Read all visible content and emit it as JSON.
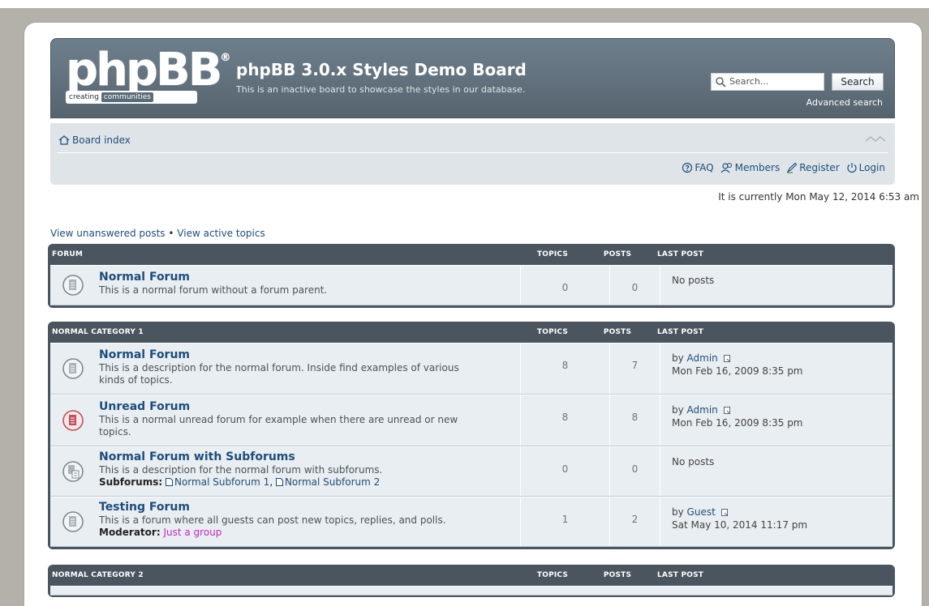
{
  "header": {
    "logo_text": "phpBB",
    "logo_reg": "®",
    "logo_tag_1": "creating",
    "logo_tag_2": "communities",
    "title": "phpBB 3.0.x Styles Demo Board",
    "description": "This is an inactive board to showcase the styles in our database.",
    "search_placeholder": "Search...",
    "search_button": "Search",
    "advanced_search": "Advanced search"
  },
  "nav": {
    "board_index": "Board index",
    "links": [
      "FAQ",
      "Members",
      "Register",
      "Login"
    ]
  },
  "current_time": "It is currently Mon May 12, 2014 6:53 am",
  "quick_links": [
    "View unanswered posts",
    "•",
    "View active topics"
  ],
  "columns": {
    "topics": "TOPICS",
    "posts": "POSTS",
    "last_post": "LAST POST"
  },
  "categories": [
    {
      "name": "FORUM",
      "forums": [
        {
          "title": "Normal Forum",
          "description": "This is a normal forum without a forum parent.",
          "topics": "0",
          "posts": "0",
          "last_post": "No posts"
        }
      ]
    },
    {
      "name": "NORMAL CATEGORY 1",
      "forums": [
        {
          "title": "Normal Forum",
          "description": "This is a description for the normal forum. Inside find examples of various kinds of topics.",
          "topics": "8",
          "posts": "7",
          "last_by": "by",
          "last_author": "Admin",
          "last_date": "Mon Feb 16, 2009 8:35 pm"
        },
        {
          "title": "Unread Forum",
          "description": "This is a normal unread forum for example when there are unread or new topics.",
          "topics": "8",
          "posts": "8",
          "last_by": "by",
          "last_author": "Admin",
          "last_date": "Mon Feb 16, 2009 8:35 pm"
        },
        {
          "title": "Normal Forum with Subforums",
          "description": "This is a description for the normal forum with subforums.",
          "subforums_label": "Subforums:",
          "subforums": [
            "Normal Subforum 1",
            "Normal Subforum 2"
          ],
          "topics": "0",
          "posts": "0",
          "last_post": "No posts"
        },
        {
          "title": "Testing Forum",
          "description": "This is a forum where all guests can post new topics, replies, and polls.",
          "moderator_label": "Moderator:",
          "moderator": "Just a group",
          "topics": "1",
          "posts": "2",
          "last_by": "by",
          "last_author": "Guest",
          "last_date": "Sat May 10, 2014 11:17 pm"
        }
      ]
    },
    {
      "name": "NORMAL CATEGORY 2",
      "forums": []
    }
  ],
  "colors": {
    "header": "#5f6f7b",
    "link": "#1e4d7a",
    "unread_icon": "#c0505a",
    "moderator": "#c128c1"
  }
}
